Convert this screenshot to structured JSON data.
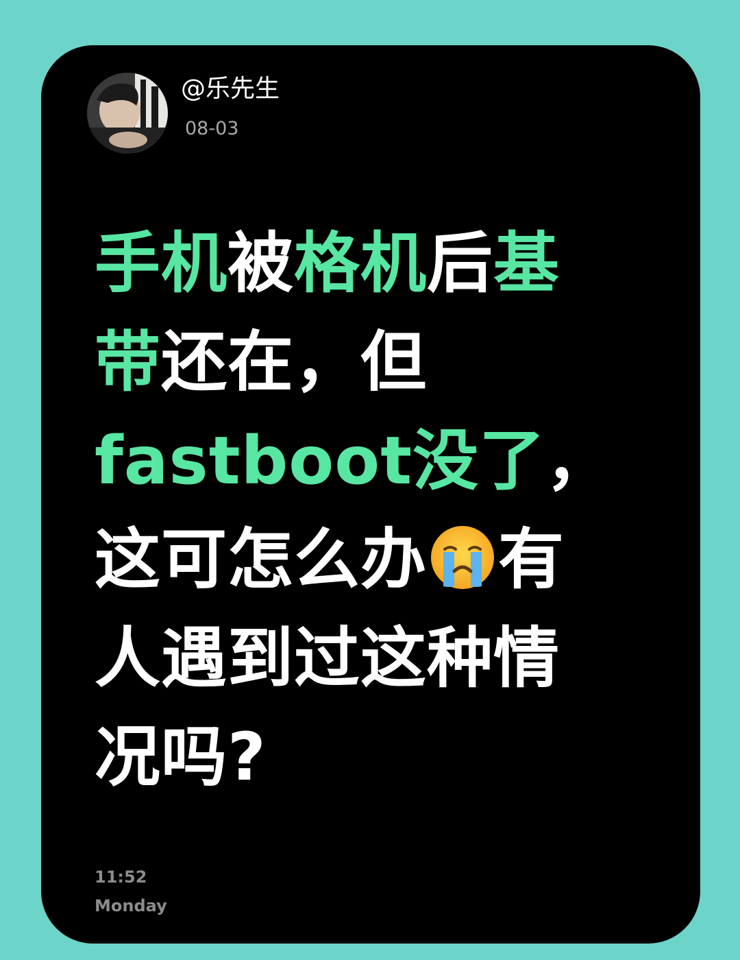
{
  "post": {
    "author": "@乐先生",
    "date": "08-03",
    "text": {
      "seg1": "手机",
      "seg2": "被",
      "seg3": "格机",
      "seg4": "后",
      "seg5": "基",
      "seg6": "带",
      "seg7": "还在，但",
      "seg8": "fastboot没了",
      "seg9": "，",
      "seg10": "这可怎么办",
      "seg11": "有",
      "seg12": "人遇到过这种情",
      "seg13": "况吗?"
    },
    "emoji_icon": "loudly-crying-face-icon",
    "time": "11:52",
    "weekday": "Monday"
  },
  "colors": {
    "background": "#6dd4c9",
    "card": "#000000",
    "highlight": "#58e6a3",
    "text": "#ffffff",
    "meta": "#8c8c8c"
  }
}
